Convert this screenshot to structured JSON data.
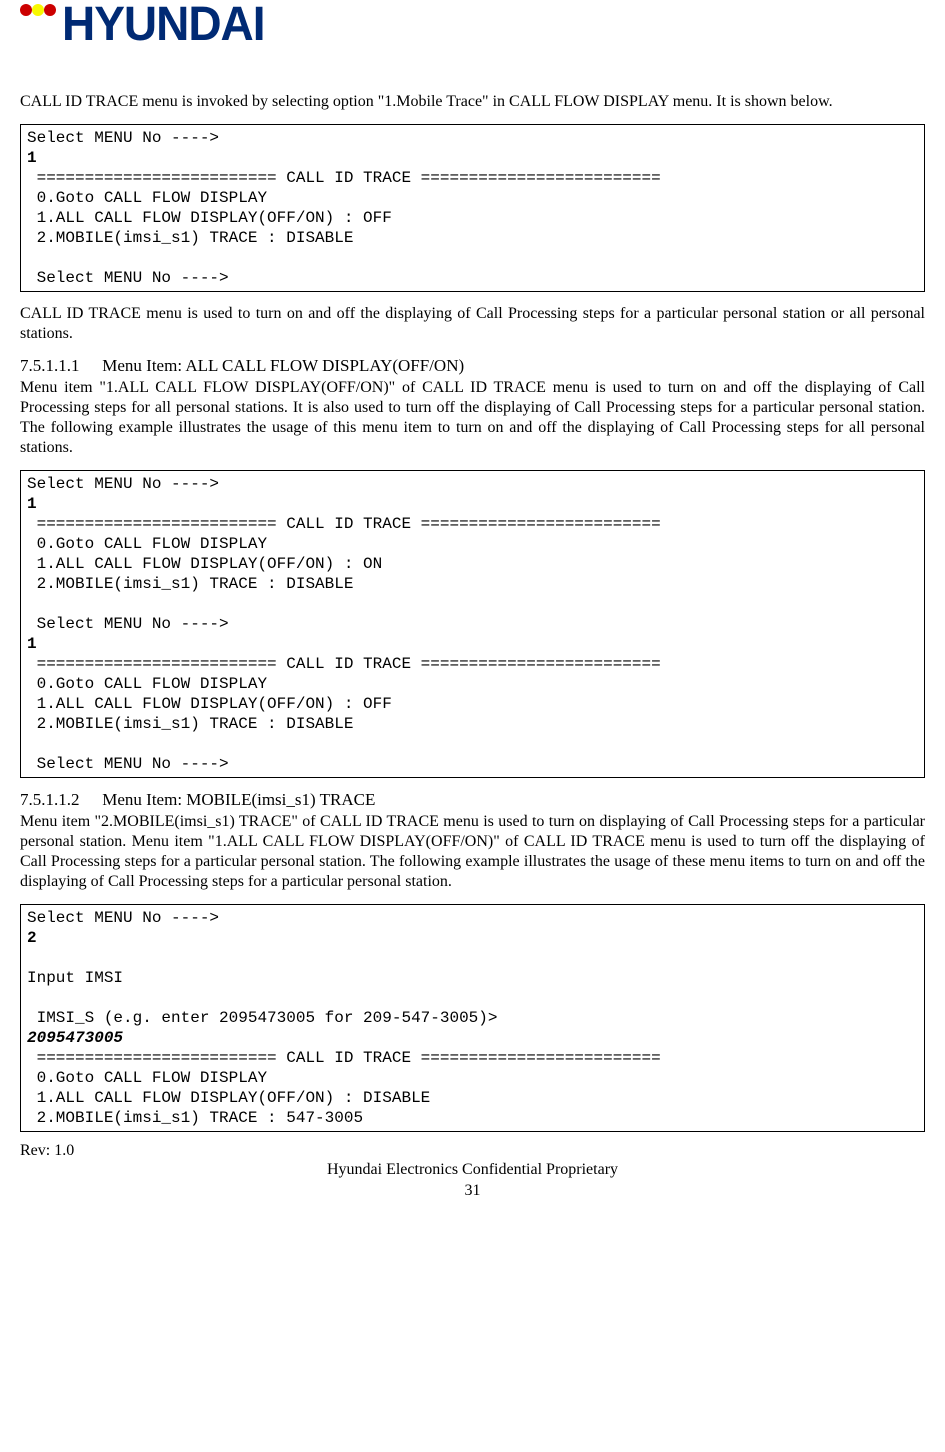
{
  "header": {
    "wordmark": "HYUNDAI"
  },
  "p1": "CALL ID TRACE menu is invoked by selecting option \"1.Mobile Trace\" in CALL FLOW DISPLAY menu. It is shown below.",
  "code1": {
    "l0": "Select MENU No ---->",
    "l1": "1",
    "l2": " ========================= CALL ID TRACE =========================",
    "l3": " 0.Goto CALL FLOW DISPLAY",
    "l4": " 1.ALL CALL FLOW DISPLAY(OFF/ON) : OFF",
    "l5": " 2.MOBILE(imsi_s1) TRACE : DISABLE",
    "l6": "",
    "l7": " Select MENU No ---->"
  },
  "p2": "CALL ID TRACE menu is used to turn on and off the displaying of Call Processing steps for a particular personal station or all personal stations.",
  "h1": {
    "num": "7.5.1.1.1",
    "title": "Menu Item: ALL CALL FLOW DISPLAY(OFF/ON)"
  },
  "p3": "Menu item \"1.ALL CALL FLOW DISPLAY(OFF/ON)\" of CALL ID TRACE menu is used to turn on and off the displaying of Call Processing steps for all personal stations. It is also used to turn off the displaying of Call Processing steps for a particular personal station. The following example illustrates the usage of this menu item to turn on and off the displaying of Call Processing steps for all personal stations.",
  "code2": {
    "l0": "Select MENU No ---->",
    "l1": "1",
    "l2": " ========================= CALL ID TRACE =========================",
    "l3": " 0.Goto CALL FLOW DISPLAY",
    "l4": " 1.ALL CALL FLOW DISPLAY(OFF/ON) : ON",
    "l5": " 2.MOBILE(imsi_s1) TRACE : DISABLE",
    "l6": "",
    "l7": " Select MENU No ---->",
    "l8": "1",
    "l9": " ========================= CALL ID TRACE =========================",
    "l10": " 0.Goto CALL FLOW DISPLAY",
    "l11": " 1.ALL CALL FLOW DISPLAY(OFF/ON) : OFF",
    "l12": " 2.MOBILE(imsi_s1) TRACE : DISABLE",
    "l13": "",
    "l14": " Select MENU No ---->"
  },
  "h2": {
    "num": "7.5.1.1.2",
    "title": "Menu Item: MOBILE(imsi_s1) TRACE"
  },
  "p4": "Menu item \"2.MOBILE(imsi_s1) TRACE\" of CALL ID TRACE menu is used to turn on displaying of Call Processing steps for a particular personal station. Menu item \"1.ALL CALL FLOW DISPLAY(OFF/ON)\" of CALL ID TRACE menu is used to turn off the displaying of Call Processing steps for a particular personal station. The following example illustrates the usage of these menu items to turn on and off the displaying of Call Processing steps for a particular personal station.",
  "code3": {
    "l0": "Select MENU No ---->",
    "l1": "2",
    "l2": "",
    "l3": "Input IMSI",
    "l4": "",
    "l5": " IMSI_S (e.g. enter 2095473005 for 209-547-3005)>",
    "l6": "2095473005",
    "l7": " ========================= CALL ID TRACE =========================",
    "l8": " 0.Goto CALL FLOW DISPLAY",
    "l9": " 1.ALL CALL FLOW DISPLAY(OFF/ON) : DISABLE",
    "l10": " 2.MOBILE(imsi_s1) TRACE : 547-3005"
  },
  "footer": {
    "rev": "Rev: 1.0",
    "conf": "Hyundai Electronics Confidential Proprietary",
    "page": "31"
  }
}
